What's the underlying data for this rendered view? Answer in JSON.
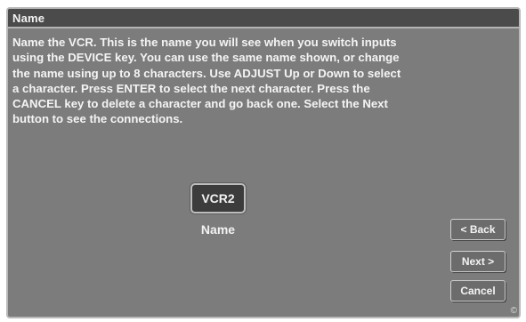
{
  "window": {
    "title": "Name"
  },
  "instructions": "Name the VCR.  This is the name you will see when you switch inputs\nusing the DEVICE key.  You can use the same name shown, or change\nthe name using up to 8 characters. Use ADJUST Up or Down to select\na character.  Press ENTER to select the next character.  Press the\nCANCEL key to delete a character and go back one.  Select the Next\nbutton to see the connections.",
  "name_field": {
    "value": "VCR2",
    "caption": "Name"
  },
  "buttons": {
    "back": "< Back",
    "next": "Next >",
    "cancel": "Cancel"
  },
  "footer": {
    "copyright_symbol": "©"
  }
}
